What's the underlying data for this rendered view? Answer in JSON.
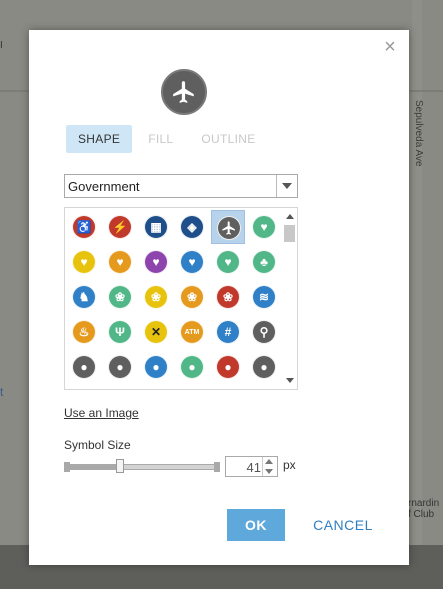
{
  "map": {
    "street_label": "Sepulveda Ave",
    "poi_label": "rnardin\nf Club",
    "edge_label_left": "t",
    "edge_label_top": "I"
  },
  "dialog": {
    "close_glyph": "×",
    "preview_icon": "airplane-icon",
    "preview_color": "#5f5f5f",
    "tabs": [
      {
        "label": "SHAPE",
        "active": true
      },
      {
        "label": "FILL",
        "active": false
      },
      {
        "label": "OUTLINE",
        "active": false
      }
    ],
    "category": {
      "selected": "Government"
    },
    "symbols": [
      {
        "icon": "accessibility-icon",
        "color": "#c0392b"
      },
      {
        "icon": "defibrillator-icon",
        "color": "#c0392b"
      },
      {
        "icon": "government-building-icon",
        "color": "#1f4f8b"
      },
      {
        "icon": "map-info-icon",
        "color": "#1f4f8b"
      },
      {
        "icon": "airplane-icon",
        "color": "#5f5f5f",
        "selected": true
      },
      {
        "icon": "heart-leaf-icon",
        "color": "#52b788"
      },
      {
        "icon": "heart-icon",
        "color": "#e8c30e"
      },
      {
        "icon": "heart-leaf-icon",
        "color": "#e59a1e"
      },
      {
        "icon": "heart-leaf-icon",
        "color": "#8e44ad"
      },
      {
        "icon": "heart-leaf-icon",
        "color": "#2f80c6"
      },
      {
        "icon": "heart-leaf-icon",
        "color": "#52b788"
      },
      {
        "icon": "tree-icon",
        "color": "#52b788"
      },
      {
        "icon": "horse-icon",
        "color": "#2f80c6"
      },
      {
        "icon": "paw-icon",
        "color": "#52b788"
      },
      {
        "icon": "paw-icon",
        "color": "#e8c30e"
      },
      {
        "icon": "paw-icon",
        "color": "#e59a1e"
      },
      {
        "icon": "paw-icon",
        "color": "#c0392b"
      },
      {
        "icon": "water-icon",
        "color": "#2f80c6"
      },
      {
        "icon": "fire-icon",
        "color": "#e59a1e"
      },
      {
        "icon": "coral-icon",
        "color": "#52b788"
      },
      {
        "icon": "railroad-crossing-icon",
        "color": "#e8c30e"
      },
      {
        "icon": "atm-icon",
        "color": "#e59a1e",
        "text": "ATM"
      },
      {
        "icon": "hashtag-icon",
        "color": "#2f80c6"
      },
      {
        "icon": "bicycle-icon",
        "color": "#5f5f5f"
      },
      {
        "icon": "symbol-icon",
        "color": "#5f5f5f"
      },
      {
        "icon": "symbol-icon",
        "color": "#5f5f5f"
      },
      {
        "icon": "symbol-icon",
        "color": "#2f80c6"
      },
      {
        "icon": "symbol-icon",
        "color": "#52b788"
      },
      {
        "icon": "symbol-icon",
        "color": "#c0392b"
      },
      {
        "icon": "symbol-icon",
        "color": "#5f5f5f"
      }
    ],
    "use_image_label": "Use an Image",
    "symbol_size_label": "Symbol Size",
    "symbol_size_value": "41",
    "symbol_size_fraction": 0.36,
    "symbol_size_unit": "px",
    "ok_label": "OK",
    "cancel_label": "CANCEL",
    "accent_color": "#5ea8db"
  }
}
